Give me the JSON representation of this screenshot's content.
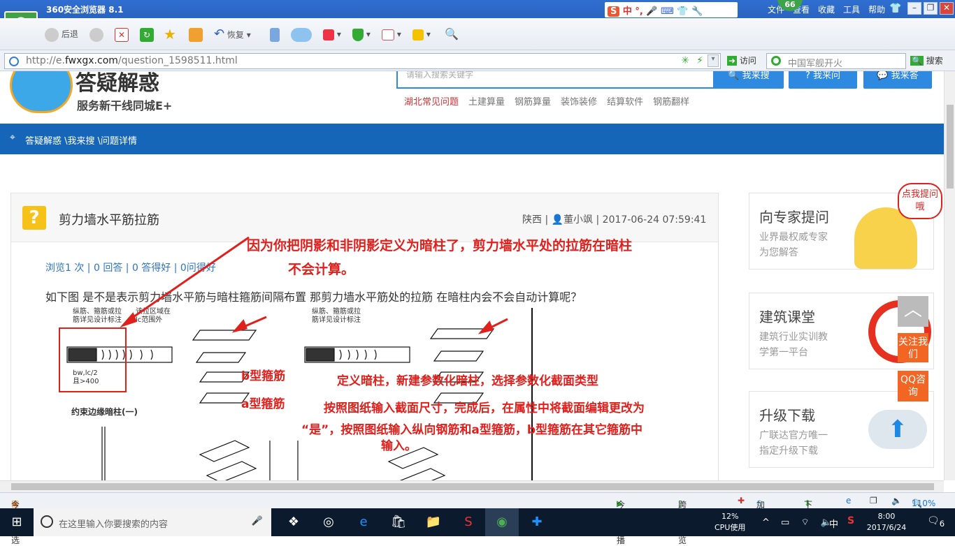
{
  "browser": {
    "title": "360安全浏览器 8.1",
    "menu": [
      "文件",
      "查看",
      "收藏",
      "工具",
      "帮助"
    ],
    "badge": "66",
    "ime": "中 °, ",
    "toolbar": {
      "back": "后退",
      "restore": "恢复"
    },
    "url_prefix": "http://e.",
    "url_domain": "fwxgx.com",
    "url_path": "/question_1598511.html",
    "visit": "访问",
    "search_placeholder": "中国军舰开火",
    "search_btn": "搜索"
  },
  "site": {
    "logo_main": "答疑解惑",
    "logo_sub": "服务新干线同城E+",
    "search_placeholder": "请输入搜索关键字",
    "btn_search": "我来搜",
    "btn_ask": "我来问",
    "btn_answer": "我来答",
    "hot_links": [
      "湖北常见问题",
      "土建算量",
      "钢筋算量",
      "装饰装修",
      "结算软件",
      "钢筋翻样"
    ],
    "breadcrumb": "答疑解惑 \\我来搜 \\问题详情"
  },
  "question": {
    "icon": "?",
    "title": "剪力墙水平筋拉筋",
    "meta_region": "陕西 |",
    "meta_user": "董小飒",
    "meta_time": "| 2017-06-24 07:59:41",
    "stats": "浏览1 次 | 0 回答 | 0 答得好 | 0问得好",
    "body": "如下图 是不是表示剪力墙水平筋与暗柱箍筋间隔布置 那剪力墙水平筋处的拉筋 在暗柱内会不会自动计算呢？"
  },
  "annotations": {
    "line1": "因为你把阴影和非阴影定义为暗柱了，剪力墙水平处的拉筋在暗柱",
    "line2": "不会计算。",
    "b_label": "b型箍筋",
    "a_label": "a型箍筋",
    "step1": "定义暗柱，新建参数化暗柱，选择参数化截面类型",
    "step2": "按照图纸输入截面尺寸，完成后，在属性中将截面编辑更改为",
    "step3": "“是”，按照图纸输入纵向钢筋和a型箍筋，b型箍筋在其它箍筋中",
    "step4": "输入。"
  },
  "drawing": {
    "note1": "纵筋、箍筋或拉",
    "note2": "筋详见设计标注",
    "note3": "该拉区域在",
    "note4": "lc范围外",
    "caption": "约束边缘暗柱(一)",
    "dim": "bw,lc/2",
    "dim2": "且>400"
  },
  "sidebar": {
    "expert_title": "向专家提问",
    "expert_desc1": "业界最权威专家",
    "expert_desc2": "为您解答",
    "bubble": "点我提问哦",
    "class_title": "建筑课堂",
    "class_desc1": "建筑行业实训教",
    "class_desc2": "学第一平台",
    "upgrade_title": "升级下载",
    "upgrade_desc1": "广联达官方唯一",
    "upgrade_desc2": "指定升级下载",
    "follow": "关注我们",
    "qq": "QQ咨询"
  },
  "status": {
    "left": "今日优选",
    "live": "今日直播",
    "cross": "跨屏浏览",
    "accel": "加速器",
    "download": "下载",
    "zoom": "110%"
  },
  "taskbar": {
    "search": "在这里输入你要搜索的内容",
    "cpu_pct": "12%",
    "cpu_label": "CPU使用",
    "ime": "中",
    "time": "8:00",
    "date": "2017/6/24",
    "notif": "6"
  }
}
